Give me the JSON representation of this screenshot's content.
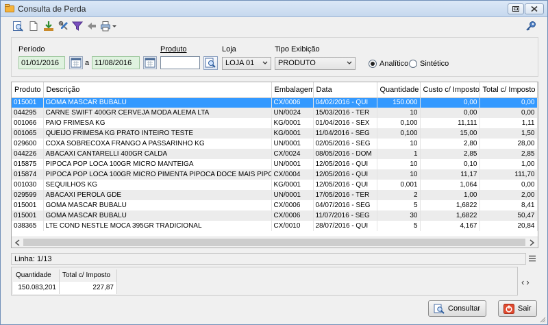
{
  "window": {
    "title": "Consulta de Perda"
  },
  "toolbar": {
    "icons": [
      "search-document-icon",
      "blank-document-icon",
      "download-icon",
      "tools-icon",
      "filter-icon",
      "back-arrow-icon",
      "print-icon",
      "dropdown-caret-icon",
      "key-icon"
    ]
  },
  "filters": {
    "periodo_label": "Período",
    "date_from": "01/01/2016",
    "date_sep": "a",
    "date_to": "11/08/2016",
    "produto_label": "Produto",
    "produto_value": "",
    "loja_label": "Loja",
    "loja_value": "LOJA 01",
    "tipo_label": "Tipo Exibição",
    "tipo_value": "PRODUTO",
    "radio_analitico": "Analítico",
    "radio_sintetico": "Sintético",
    "selected_mode": "Analítico"
  },
  "grid": {
    "columns": [
      "Produto",
      "Descrição",
      "Embalagem",
      "Data",
      "Quantidade",
      "Custo c/ Imposto",
      "Total c/ Imposto"
    ],
    "rows": [
      [
        "015001",
        "GOMA MASCAR BUBALU",
        "CX/0006",
        "04/02/2016 - QUI",
        "150.000",
        "0,00",
        "0,00"
      ],
      [
        "044295",
        "CARNE SWIFT 400GR CERVEJA MODA ALEMA LTA",
        "UN/0024",
        "15/03/2016 - TER",
        "10",
        "0,00",
        "0,00"
      ],
      [
        "001066",
        "PAIO FRIMESA KG",
        "KG/0001",
        "01/04/2016 - SEX",
        "0,100",
        "11,111",
        "1,11"
      ],
      [
        "001065",
        "QUEIJO FRIMESA KG PRATO INTEIRO TESTE",
        "KG/0001",
        "11/04/2016 - SEG",
        "0,100",
        "15,00",
        "1,50"
      ],
      [
        "029600",
        "COXA SOBRECOXA FRANGO A PASSARINHO KG",
        "UN/0001",
        "02/05/2016 - SEG",
        "10",
        "2,80",
        "28,00"
      ],
      [
        "044226",
        "ABACAXI CANTARELLI 400GR CALDA",
        "CX/0024",
        "08/05/2016 - DOM",
        "1",
        "2,85",
        "2,85"
      ],
      [
        "015875",
        "PIPOCA POP LOCA 100GR MICRO MANTEIGA",
        "UN/0001",
        "12/05/2016 - QUI",
        "10",
        "0,10",
        "1,00"
      ],
      [
        "015874",
        "PIPOCA POP LOCA 100GR MICRO PIMENTA PIPOCA DOCE MAIS PIPOCA",
        "CX/0004",
        "12/05/2016 - QUI",
        "10",
        "11,17",
        "111,70"
      ],
      [
        "001030",
        "SEQUILHOS KG",
        "KG/0001",
        "12/05/2016 - QUI",
        "0,001",
        "1,064",
        "0,00"
      ],
      [
        "029599",
        "ABACAXI PEROLA GDE",
        "UN/0001",
        "17/05/2016 - TER",
        "2",
        "1,00",
        "2,00"
      ],
      [
        "015001",
        "GOMA MASCAR BUBALU",
        "CX/0006",
        "04/07/2016 - SEG",
        "5",
        "1,6822",
        "8,41"
      ],
      [
        "015001",
        "GOMA MASCAR BUBALU",
        "CX/0006",
        "11/07/2016 - SEG",
        "30",
        "1,6822",
        "50,47"
      ],
      [
        "038365",
        "LTE COND NESTLE MOCA 395GR TRADICIONAL",
        "CX/0010",
        "28/07/2016 - QUI",
        "5",
        "4,167",
        "20,84"
      ]
    ]
  },
  "status": {
    "linha": "Linha: 1/13"
  },
  "totals": {
    "quantidade_label": "Quantidade",
    "quantidade_value": "150.083,201",
    "total_label": "Total c/ Imposto",
    "total_value": "227,87"
  },
  "buttons": {
    "consultar": "Consultar",
    "sair": "Sair"
  }
}
